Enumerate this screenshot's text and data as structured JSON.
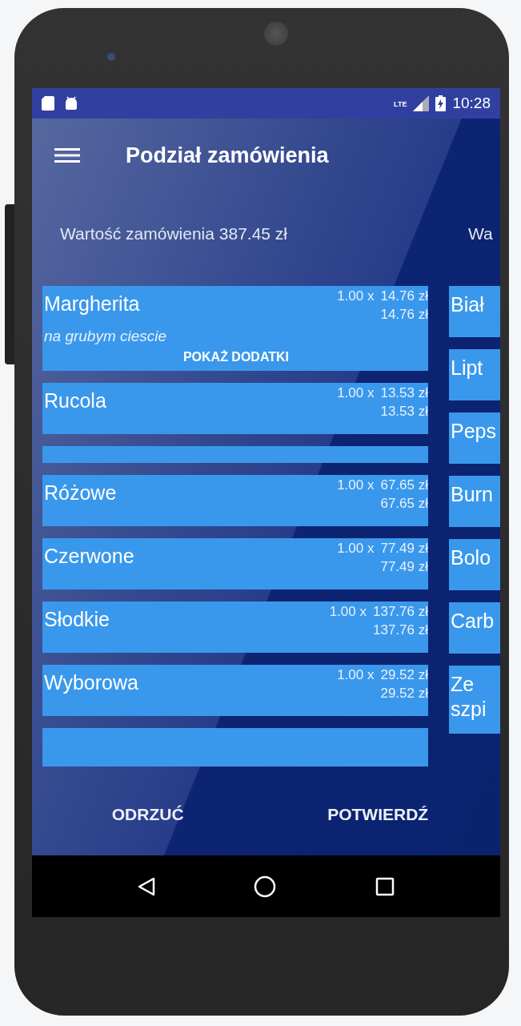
{
  "status_bar": {
    "network": "LTE",
    "time": "10:28"
  },
  "app_bar": {
    "title": "Podział zamówienia"
  },
  "pages": [
    {
      "header": "Wartość zamówienia 387.45 zł",
      "items": [
        {
          "kind": "item",
          "name": "Margherita",
          "qty": "1.00 x",
          "unit_price": "14.76 zł",
          "total": "14.76 zł",
          "note": "na grubym ciescie",
          "extras_button": "POKAŻ DODATKI"
        },
        {
          "kind": "item",
          "name": "Rucola",
          "qty": "1.00 x",
          "unit_price": "13.53 zł",
          "total": "13.53 zł"
        },
        {
          "kind": "blank"
        },
        {
          "kind": "item",
          "name": "Różowe",
          "qty": "1.00 x",
          "unit_price": "67.65 zł",
          "total": "67.65 zł"
        },
        {
          "kind": "item",
          "name": "Czerwone",
          "qty": "1.00 x",
          "unit_price": "77.49 zł",
          "total": "77.49 zł"
        },
        {
          "kind": "item",
          "name": "Słodkie",
          "qty": "1.00 x",
          "unit_price": "137.76 zł",
          "total": "137.76 zł"
        },
        {
          "kind": "item",
          "name": "Wyborowa",
          "qty": "1.00 x",
          "unit_price": "29.52 zł",
          "total": "29.52 zł"
        },
        {
          "kind": "cut"
        }
      ]
    },
    {
      "header": "Wa",
      "items": [
        {
          "kind": "item",
          "name": "Biał"
        },
        {
          "kind": "item",
          "name": "Lipt"
        },
        {
          "kind": "item",
          "name": "Peps"
        },
        {
          "kind": "item",
          "name": "Burn"
        },
        {
          "kind": "item",
          "name": "Bolo"
        },
        {
          "kind": "item",
          "name": "Carb"
        },
        {
          "kind": "item",
          "name": "Ze szpi"
        }
      ]
    }
  ],
  "buttons": [
    "ODRZUĆ",
    "POTWIERDŹ"
  ]
}
